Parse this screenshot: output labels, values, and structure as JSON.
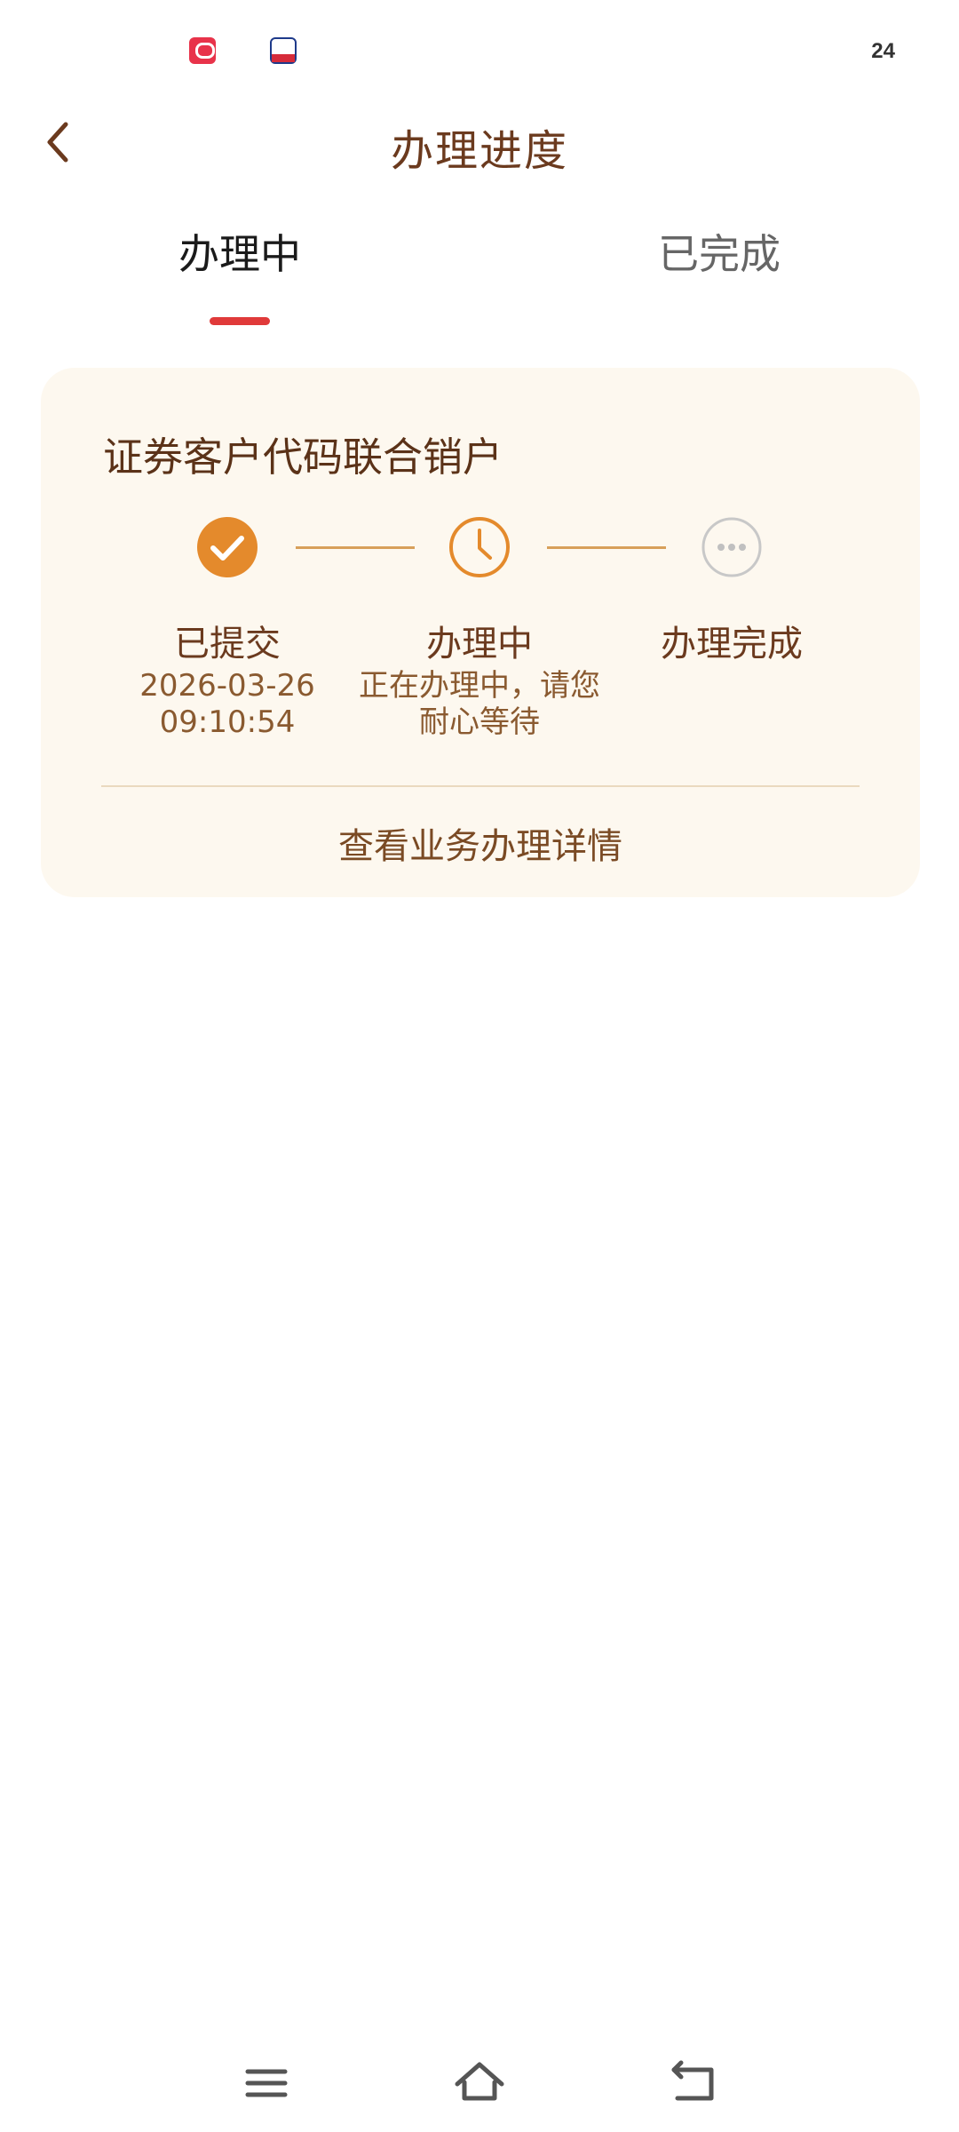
{
  "status_bar": {
    "time": "24",
    "app_icons": [
      "app-icon-red",
      "app-icon-bank"
    ]
  },
  "header": {
    "title": "办理进度",
    "back_icon": "chevron-left-icon"
  },
  "tabs": [
    {
      "label": "办理中",
      "active": true
    },
    {
      "label": "已完成",
      "active": false
    }
  ],
  "card": {
    "title": "证券客户代码联合销户",
    "steps": [
      {
        "label": "已提交",
        "status": "done",
        "icon": "check-circle-icon",
        "sub_line1": "2026-03-26",
        "sub_line2": "09:10:54"
      },
      {
        "label": "办理中",
        "status": "current",
        "icon": "clock-icon",
        "sub_line1": "正在办理中，请您",
        "sub_line2": "耐心等待"
      },
      {
        "label": "办理完成",
        "status": "pending",
        "icon": "more-dots-icon"
      }
    ],
    "details_link": "查看业务办理详情"
  },
  "colors": {
    "accent_orange": "#e48a2c",
    "title_brown": "#6b3a1e",
    "tab_indicator_red": "#e03a3a",
    "card_background": "#fdf8ef",
    "pending_gray": "#c8c8c8"
  },
  "nav_bar": {
    "icons": [
      "menu-icon",
      "home-icon",
      "back-icon"
    ]
  }
}
